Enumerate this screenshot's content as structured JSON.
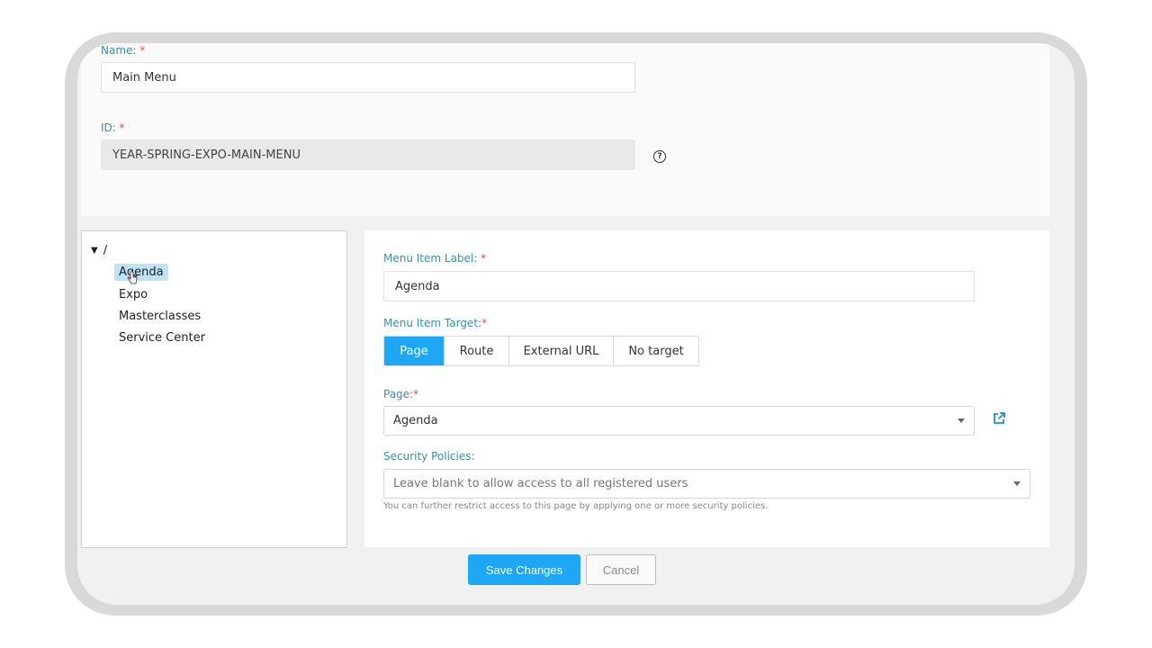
{
  "form": {
    "name_label": "Name:",
    "name_required": "*",
    "name_value": "Main Menu",
    "id_label": "ID:",
    "id_required": "*",
    "id_value": "YEAR-SPRING-EXPO-MAIN-MENU",
    "help_glyph": "?"
  },
  "tree": {
    "caret": "▼",
    "root_label": "/",
    "items": [
      {
        "label": "Agenda",
        "selected": true
      },
      {
        "label": "Expo",
        "selected": false
      },
      {
        "label": "Masterclasses",
        "selected": false
      },
      {
        "label": "Service Center",
        "selected": false
      }
    ]
  },
  "detail": {
    "label_label": "Menu Item Label:",
    "label_required": "*",
    "label_value": "Agenda",
    "target_label": "Menu Item Target:",
    "target_required": "*",
    "target_options": [
      "Page",
      "Route",
      "External URL",
      "No target"
    ],
    "target_selected": "Page",
    "page_label": "Page:",
    "page_required": "*",
    "page_value": "Agenda",
    "security_label": "Security Policies:",
    "security_placeholder": "Leave blank to allow access to all registered users",
    "security_hint": "You can further restrict access to this page by applying one or more security policies."
  },
  "actions": {
    "save_label": "Save Changes",
    "cancel_label": "Cancel"
  },
  "colors": {
    "accent": "#1ea7f5",
    "label": "#3b8fa3",
    "required": "#d9534f",
    "selected_bg": "#bfe3f5"
  }
}
